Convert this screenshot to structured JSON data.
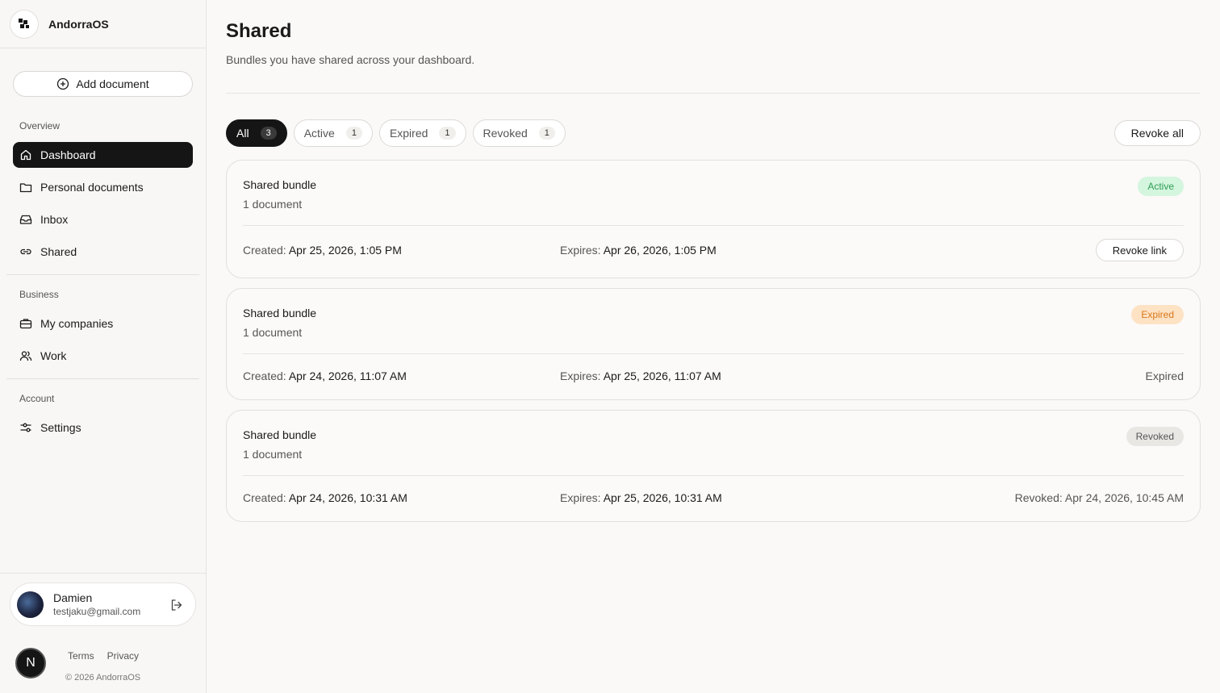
{
  "app": {
    "name": "AndorraOS"
  },
  "sidebar": {
    "add_document": "Add document",
    "sections": {
      "overview": "Overview",
      "business": "Business",
      "account": "Account"
    },
    "items": [
      {
        "label": "Dashboard",
        "icon": "home-icon"
      },
      {
        "label": "Personal documents",
        "icon": "folder-icon"
      },
      {
        "label": "Inbox",
        "icon": "inbox-icon"
      },
      {
        "label": "Shared",
        "icon": "link-icon"
      },
      {
        "label": "My companies",
        "icon": "briefcase-icon"
      },
      {
        "label": "Work",
        "icon": "users-icon"
      },
      {
        "label": "Settings",
        "icon": "sliders-icon"
      }
    ],
    "user": {
      "name": "Damien",
      "email": "testjaku@gmail.com"
    },
    "n_badge": "N",
    "footer": {
      "terms": "Terms",
      "privacy": "Privacy",
      "copyright": "© 2026 AndorraOS"
    }
  },
  "main": {
    "title": "Shared",
    "subtitle": "Bundles you have shared across your dashboard.",
    "filters": [
      {
        "label": "All",
        "count": "3"
      },
      {
        "label": "Active",
        "count": "1"
      },
      {
        "label": "Expired",
        "count": "1"
      },
      {
        "label": "Revoked",
        "count": "1"
      }
    ],
    "revoke_all": "Revoke all",
    "bundles": [
      {
        "title": "Shared bundle",
        "subtitle": "1 document",
        "status": "Active",
        "created_label": "Created:",
        "created": "Apr 25, 2026, 1:05 PM",
        "expires_label": "Expires:",
        "expires": "Apr 26, 2026, 1:05 PM",
        "action": "Revoke link"
      },
      {
        "title": "Shared bundle",
        "subtitle": "1 document",
        "status": "Expired",
        "created_label": "Created:",
        "created": "Apr 24, 2026, 11:07 AM",
        "expires_label": "Expires:",
        "expires": "Apr 25, 2026, 11:07 AM",
        "right_text": "Expired"
      },
      {
        "title": "Shared bundle",
        "subtitle": "1 document",
        "status": "Revoked",
        "created_label": "Created:",
        "created": "Apr 24, 2026, 10:31 AM",
        "expires_label": "Expires:",
        "expires": "Apr 25, 2026, 10:31 AM",
        "right_text": "Revoked: Apr 24, 2026, 10:45 AM"
      }
    ]
  },
  "colors": {
    "active_bg": "#d4f5de",
    "active_fg": "#2f9e55",
    "expired_bg": "#fde2c4",
    "expired_fg": "#d9781a",
    "revoked_bg": "#e8e7e4",
    "revoked_fg": "#555555",
    "nav_active_bg": "#151515"
  }
}
